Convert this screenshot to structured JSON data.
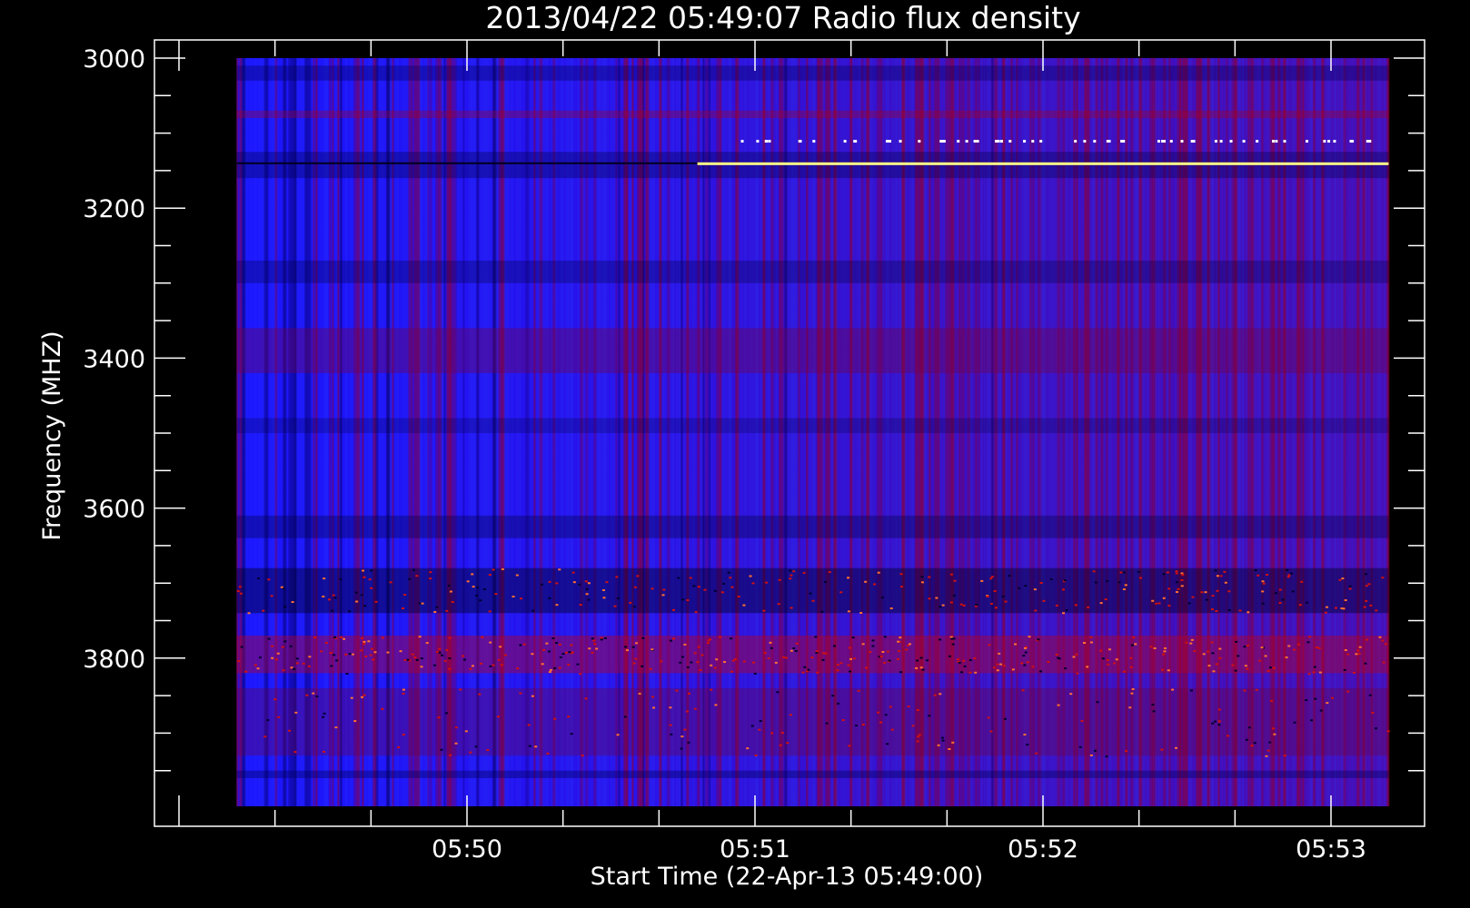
{
  "chart_data": {
    "type": "heatmap",
    "title": "2013/04/22 05:49:07 Radio flux density",
    "xlabel": "Start Time (22-Apr-13 05:49:00)",
    "ylabel": "Frequency (MHZ)",
    "x_tick_labels": [
      "05:50",
      "05:51",
      "05:52",
      "05:53"
    ],
    "x_ticks_minutes": [
      1,
      2,
      3,
      4
    ],
    "xlim_minutes": [
      0,
      4.4
    ],
    "data_x_range_minutes": [
      0.2,
      4.2
    ],
    "y_tick_labels": [
      "3000",
      "3200",
      "3400",
      "3600",
      "3800"
    ],
    "y_ticks": [
      3000,
      3200,
      3400,
      3600,
      3800
    ],
    "ylim": [
      3000,
      4000
    ],
    "y_inverted": true,
    "color_scale": [
      "#0000ff",
      "#c00000",
      "#ffff66"
    ],
    "background_color": "#000000",
    "axis_color": "#ffffff",
    "grid": false,
    "legend": "none"
  }
}
